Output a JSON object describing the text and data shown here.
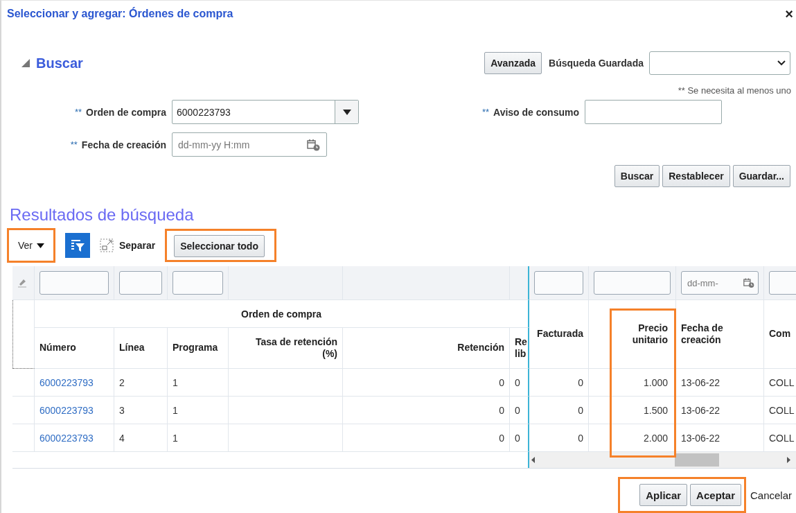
{
  "dialog": {
    "title": "Seleccionar y agregar: Órdenes de compra",
    "close": "×"
  },
  "search": {
    "heading": "Buscar",
    "expanded": true,
    "advanced_button": {
      "label": "Avanzada"
    },
    "saved_search": {
      "label": "Búsqueda Guardada"
    },
    "hint": "** Se necesita al menos uno",
    "fields": [
      {
        "marker": "**",
        "label": "Orden de compra",
        "kind": "combo",
        "value": "6000223793"
      },
      {
        "marker": "**",
        "label": "Aviso de consumo",
        "kind": "text"
      },
      {
        "marker": "**",
        "label": "Fecha de creación",
        "kind": "date",
        "placeholder": "dd-mm-yy H:mm"
      }
    ],
    "buttons": [
      {
        "label": "Buscar"
      },
      {
        "label": "Restablecer"
      },
      {
        "label": "Guardar..."
      }
    ]
  },
  "results": {
    "heading": "Resultados de búsqueda",
    "toolbar": {
      "view_menu": {
        "label": "Ver",
        "highlighted": true
      },
      "detach": {
        "label": "Separar"
      },
      "select_all": {
        "label": "Seleccionar todo",
        "highlighted": true
      }
    },
    "table": {
      "group_header": "Orden de compra",
      "frozen_columns": [
        {
          "label": "Número",
          "kind": "text"
        },
        {
          "label": "Línea",
          "kind": "text"
        },
        {
          "label": "Programa",
          "kind": "text"
        },
        {
          "label": "Tasa de retención (%)",
          "kind": "none"
        },
        {
          "label": "Retención",
          "kind": "none"
        },
        {
          "label": "Re lib",
          "kind": "none"
        }
      ],
      "scroll_columns": [
        {
          "label": "Facturada",
          "kind": "text"
        },
        {
          "label": "Precio unitario",
          "kind": "text",
          "highlighted": true
        },
        {
          "label": "Fecha de creación",
          "kind": "date",
          "placeholder": "dd-mm-"
        },
        {
          "label": "Com",
          "kind": "text"
        }
      ],
      "rows": [
        {
          "cells": [
            "6000223793",
            "2",
            "1",
            "",
            "0",
            "0",
            "0",
            "1.000",
            "13-06-22",
            "COLL"
          ]
        },
        {
          "cells": [
            "6000223793",
            "3",
            "1",
            "",
            "0",
            "0",
            "0",
            "1.500",
            "13-06-22",
            "COLL"
          ]
        },
        {
          "cells": [
            "6000223793",
            "4",
            "1",
            "",
            "0",
            "0",
            "0",
            "2.000",
            "13-06-22",
            "COLL"
          ]
        }
      ]
    }
  },
  "footer": {
    "buttons": [
      {
        "label": "Aplicar",
        "highlighted": true,
        "kind": "raised"
      },
      {
        "label": "Aceptar",
        "highlighted": true,
        "kind": "raised"
      },
      {
        "label": "Cancelar",
        "highlighted": false,
        "kind": "plain"
      }
    ]
  }
}
